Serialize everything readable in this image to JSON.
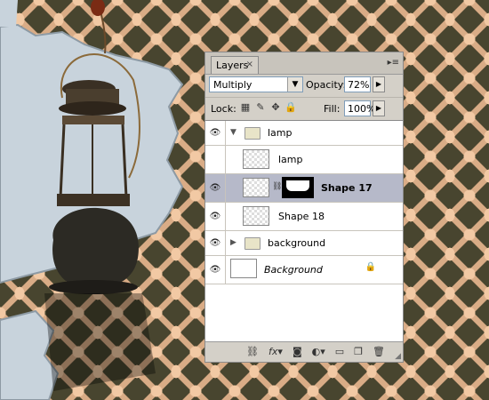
{
  "panel": {
    "tab_label": "Layers",
    "tab_close": "×",
    "menu_icon": "panel-menu-icon",
    "blend_mode": "Multiply",
    "opacity_label": "Opacity:",
    "opacity_value": "72%",
    "lock_label": "Lock:",
    "fill_label": "Fill:",
    "fill_value": "100%"
  },
  "layers": [
    {
      "name": "lamp",
      "kind": "group",
      "expanded": true,
      "visible": true
    },
    {
      "name": "lamp",
      "kind": "layer",
      "visible": false
    },
    {
      "name": "Shape 17",
      "kind": "shape-with-mask",
      "selected": true,
      "visible": true
    },
    {
      "name": "Shape 18",
      "kind": "layer",
      "visible": true
    },
    {
      "name": "background",
      "kind": "group",
      "expanded": false,
      "visible": true
    },
    {
      "name": "Background",
      "kind": "background",
      "locked": true,
      "visible": true
    }
  ],
  "bottom_icons": [
    "link-layers-icon",
    "fx-icon",
    "add-mask-icon",
    "adjustment-layer-icon",
    "new-group-icon",
    "new-layer-icon",
    "trash-icon"
  ],
  "colors": {
    "pattern_dark": "#48452f",
    "pattern_light": "#f2c9a4",
    "panel_bg": "#d4d0c8",
    "selected_row": "#b6b9c9"
  }
}
